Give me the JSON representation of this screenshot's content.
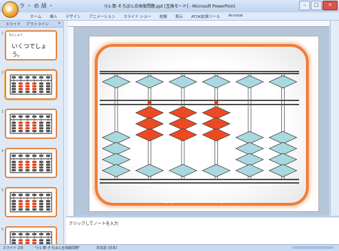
{
  "window": {
    "title": "小1-算-そろばん合体版問題.ppt [互換モード] - Microsoft PowerPoint"
  },
  "quick_access": "ラ ・ め 胡 ・",
  "ribbon": {
    "tabs": [
      "ホーム",
      "挿入",
      "デザイン",
      "アニメーション",
      "スライド ショー",
      "校閲",
      "表示",
      "ATOK拡張ツール",
      "Acrobat"
    ]
  },
  "pane_tabs": [
    "スライド",
    "アウトライン"
  ],
  "thumbnails": [
    {
      "num": "1",
      "line1": "れんしゅう",
      "line2": "いくつでしょう。"
    },
    {
      "num": "2"
    },
    {
      "num": "3"
    },
    {
      "num": "4"
    },
    {
      "num": "5"
    },
    {
      "num": "6"
    }
  ],
  "slide": {
    "copyright": "Copyright © 2008 Chieru Co.,Ltd. All rights reserved."
  },
  "abacus": {
    "rods": 6,
    "beads_active": [
      {
        "heaven": false,
        "earth_up": 0
      },
      {
        "heaven": false,
        "earth_up": 3
      },
      {
        "heaven": false,
        "earth_up": 3
      },
      {
        "heaven": false,
        "earth_up": 3
      },
      {
        "heaven": false,
        "earth_up": 0
      },
      {
        "heaven": false,
        "earth_up": 0
      }
    ],
    "colors": {
      "active": "#ee4a22",
      "inactive": "#a9d8e0",
      "frame": "#111111",
      "unit_dot": "#e3411b"
    }
  },
  "notes": {
    "placeholder": "クリックしてノートを入力"
  },
  "status": {
    "left": "スライド 2/6",
    "theme": "\"小1-算-そろばん合体版問題\"",
    "lang": "日本語 (日本)"
  },
  "colors": {
    "accent": "#ef7d3a",
    "ribbon_bg": "#dfeaf8"
  }
}
